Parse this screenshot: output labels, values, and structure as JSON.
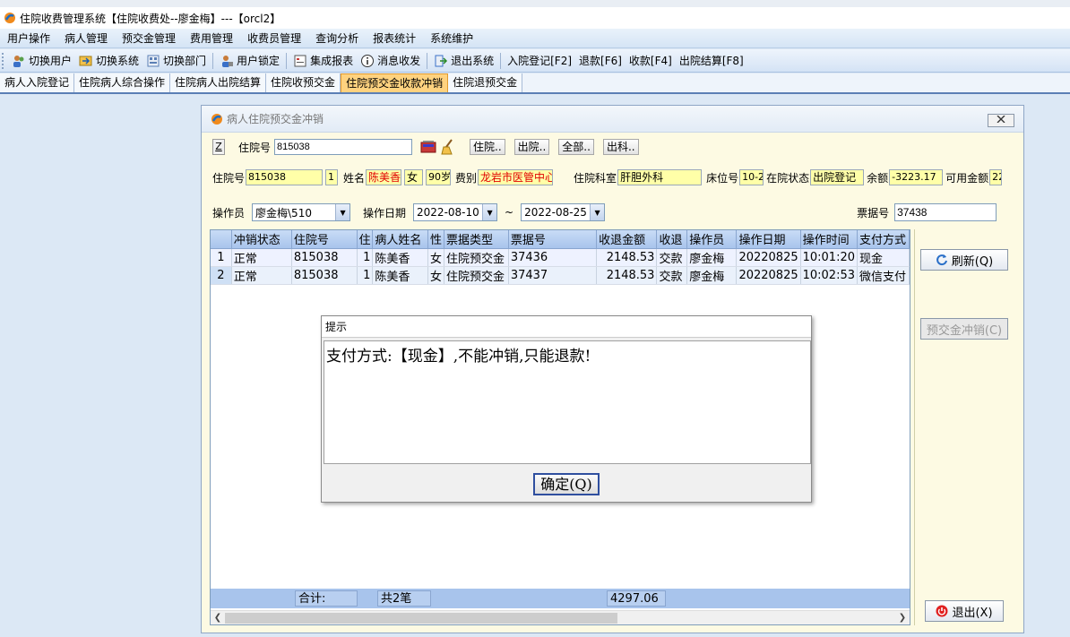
{
  "window": {
    "title": "住院收费管理系统【住院收费处--廖金梅】---【orcl2】"
  },
  "menu": [
    "用户操作",
    "病人管理",
    "预交金管理",
    "费用管理",
    "收费员管理",
    "查询分析",
    "报表统计",
    "系统维护"
  ],
  "toolbar": {
    "switch_user": "切换用户",
    "switch_system": "切换系统",
    "switch_dept": "切换部门",
    "user_lock": "用户锁定",
    "integrated_report": "集成报表",
    "message": "消息收发",
    "exit_system": "退出系统",
    "admission": "入院登记[F2]",
    "refund": "退款[F6]",
    "charge": "收款[F4]",
    "discharge": "出院结算[F8]"
  },
  "tabs": [
    "病人入院登记",
    "住院病人综合操作",
    "住院病人出院结算",
    "住院收预交金",
    "住院预交金收款冲销",
    "住院退预交金"
  ],
  "dialog": {
    "title": "病人住院预交金冲销",
    "z_label": "Z",
    "search_label": "住院号",
    "search_value": "815038",
    "btn_inhospital": "住院..",
    "btn_discharged": "出院..",
    "btn_all": "全部..",
    "btn_outdept": "出科..",
    "info": {
      "hosp_no_label": "住院号",
      "hosp_no": "815038",
      "times": "1",
      "name_label": "姓名",
      "name": "陈美香",
      "sex": "女",
      "age": "90岁",
      "fee_type_label": "费别",
      "fee_type": "龙岩市医管中心",
      "dept_label": "住院科室",
      "dept": "肝胆外科",
      "bed_label": "床位号",
      "bed": "10-2",
      "status_label": "在院状态",
      "status": "出院登记",
      "balance_label": "余额",
      "balance": "-3223.17",
      "available_label": "可用金额",
      "available": "22"
    },
    "filter": {
      "operator_label": "操作员",
      "operator": "廖金梅\\510",
      "date_label": "操作日期",
      "date_from": "2022-08-10",
      "tilde": "~",
      "date_to": "2022-08-25",
      "receipt_label": "票据号",
      "receipt": "37438"
    },
    "table": {
      "headers": [
        "冲销状态",
        "住院号",
        "住",
        "病人姓名",
        "性",
        "票据类型",
        "票据号",
        "收退金额",
        "收退",
        "操作员",
        "操作日期",
        "操作时间",
        "支付方式"
      ],
      "rows": [
        {
          "rn": "1",
          "cells": [
            "正常",
            "815038",
            "1",
            "陈美香",
            "女",
            "住院预交金",
            "37436",
            "2148.53",
            "交款",
            "廖金梅",
            "20220825",
            "10:01:20",
            "现金"
          ]
        },
        {
          "rn": "2",
          "cells": [
            "正常",
            "815038",
            "1",
            "陈美香",
            "女",
            "住院预交金",
            "37437",
            "2148.53",
            "交款",
            "廖金梅",
            "20220825",
            "10:02:53",
            "微信支付"
          ]
        }
      ],
      "footer": {
        "total_label": "合计:",
        "count": "共2笔",
        "sum": "4297.06"
      }
    },
    "side": {
      "refresh": "刷新(Q)",
      "writeoff": "预交金冲销(C)",
      "exit": "退出(X)"
    }
  },
  "msgbox": {
    "title": "提示",
    "text": "支付方式:【现金】,不能冲销,只能退款!",
    "ok": "确定(Q)"
  }
}
